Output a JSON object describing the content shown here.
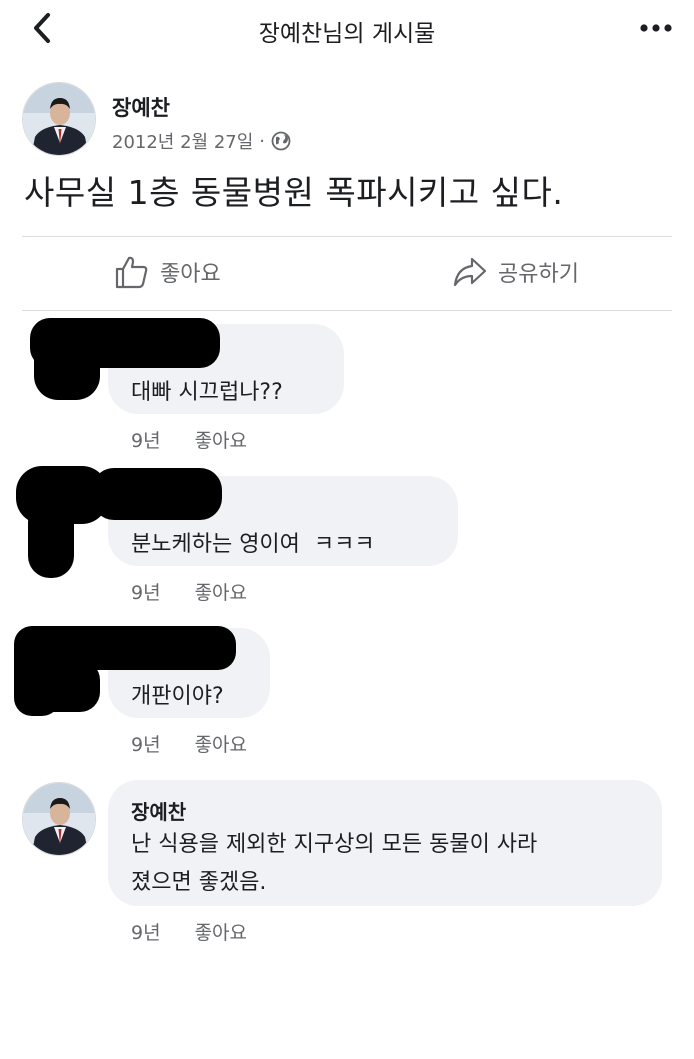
{
  "header": {
    "title": "장예찬님의 게시물",
    "back_icon": "chevron-left-icon",
    "more_icon": "more-horizontal-icon"
  },
  "post": {
    "author": "장예찬",
    "date": "2012년 2월 27일",
    "separator": "·",
    "audience_icon": "globe-icon",
    "text": "사무실 1층 동물병원 폭파시키고 싶다."
  },
  "actions": {
    "like_label": "좋아요",
    "share_label": "공유하기"
  },
  "comments": [
    {
      "author": "",
      "text": "대빠 시끄럽나??",
      "time": "9년",
      "like_label": "좋아요"
    },
    {
      "author": "",
      "text": "분노케하는 영이여  ㅋㅋㅋ",
      "time": "9년",
      "like_label": "좋아요"
    },
    {
      "author": "",
      "text": "개판이야?",
      "time": "9년",
      "like_label": "좋아요"
    },
    {
      "author": "장예찬",
      "text_line1": "난 식용을 제외한 지구상의 모든 동물이 사라",
      "text_line2": "졌으면 좋겠음.",
      "time": "9년",
      "like_label": "좋아요"
    }
  ]
}
